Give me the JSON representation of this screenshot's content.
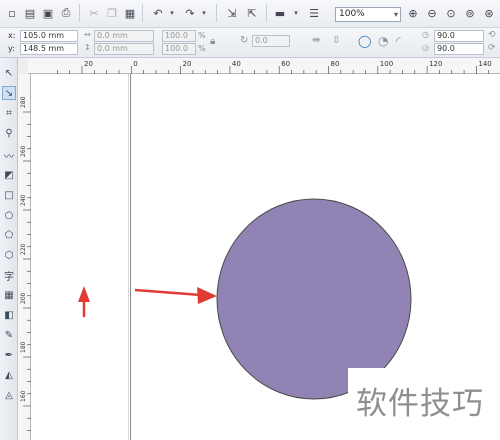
{
  "toolbar": {
    "zoom_value": "100%",
    "buttons": [
      "new-icon",
      "open-icon",
      "save-icon",
      "print-icon",
      "cut-icon",
      "copy-icon",
      "paste-icon",
      "undo-icon",
      "redo-icon",
      "import-icon",
      "export-icon",
      "app-launcher-icon",
      "options-icon",
      "zoom-in-icon",
      "zoom-out-icon",
      "zoom-selected-icon",
      "zoom-all-icon",
      "zoom-page-icon",
      "zoom-width-icon"
    ]
  },
  "propbar": {
    "x_label": "x:",
    "x_value": "105.0 mm",
    "y_label": "y:",
    "y_value": "148.5 mm",
    "w_value": "0.0 mm",
    "h_value": "0.0 mm",
    "scale_x": "100.0",
    "scale_y": "100.0",
    "pct": "%",
    "angle_value": "0.0",
    "start_angle": "90.0",
    "end_angle": "90.0"
  },
  "ruler": {
    "h_ticks": [
      "20",
      "0",
      "20",
      "40",
      "60",
      "80",
      "100",
      "120",
      "140"
    ],
    "v_ticks": [
      "280",
      "260",
      "240",
      "220",
      "200",
      "180",
      "160"
    ]
  },
  "tools": [
    "pick-tool-icon",
    "shape-tool-icon",
    "crop-tool-icon",
    "zoom-tool-icon",
    "freehand-tool-icon",
    "smart-fill-icon",
    "rectangle-tool-icon",
    "ellipse-tool-icon",
    "polygon-tool-icon",
    "basic-shapes-icon",
    "text-tool-icon",
    "table-tool-icon",
    "interactive-tool-icon",
    "eyedropper-tool-icon",
    "outline-tool-icon",
    "fill-tool-icon",
    "interactive-fill-icon"
  ],
  "canvas": {
    "shape_fill": "#9183b4",
    "shape_stroke": "#4a4a4a",
    "arrow_color": "#e03c34"
  },
  "watermark": "软件技巧"
}
